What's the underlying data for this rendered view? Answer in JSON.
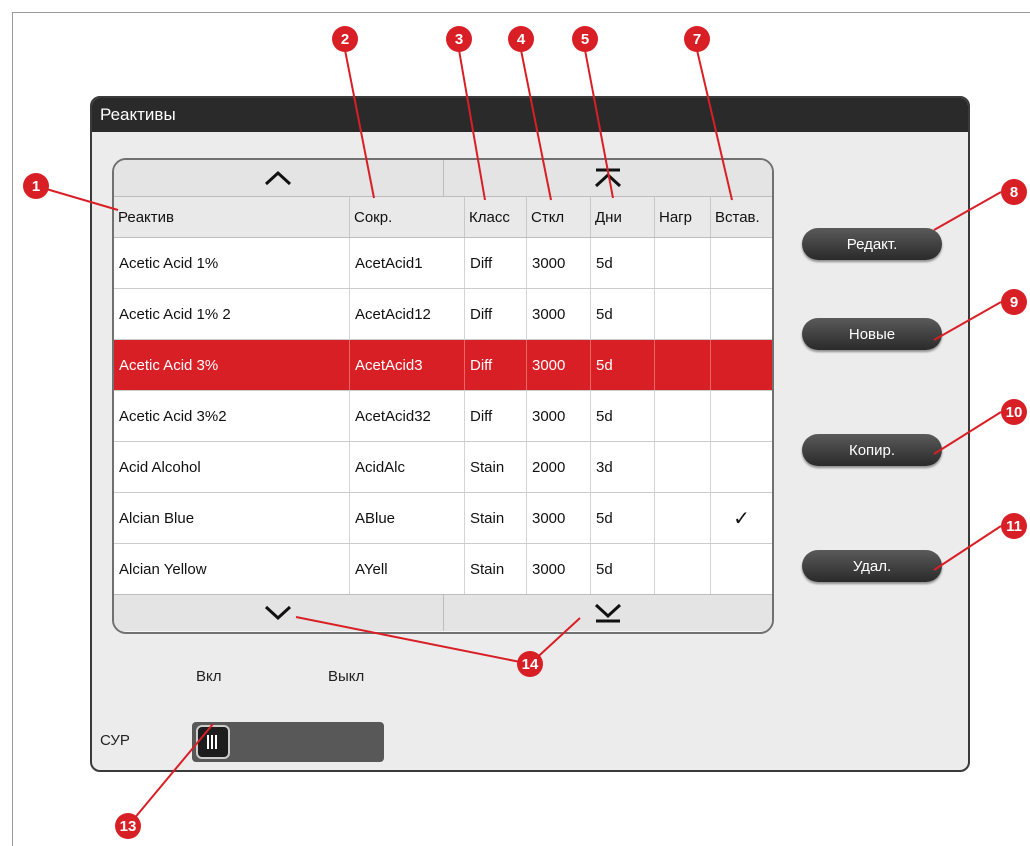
{
  "dialog": {
    "title": "Реактивы"
  },
  "table": {
    "columns": [
      "Реактив",
      "Сокр.",
      "Класс",
      "Сткл",
      "Дни",
      "Нагр",
      "Встав."
    ],
    "rows": [
      {
        "name": "Acetic Acid 1%",
        "abbr": "AcetAcid1",
        "class": "Diff",
        "stkl": "3000",
        "days": "5d",
        "nagr": "",
        "vstav": ""
      },
      {
        "name": "Acetic Acid 1% 2",
        "abbr": "AcetAcid12",
        "class": "Diff",
        "stkl": "3000",
        "days": "5d",
        "nagr": "",
        "vstav": ""
      },
      {
        "name": "Acetic Acid 3%",
        "abbr": "AcetAcid3",
        "class": "Diff",
        "stkl": "3000",
        "days": "5d",
        "nagr": "",
        "vstav": "",
        "selected": true
      },
      {
        "name": "Acetic Acid 3%2",
        "abbr": "AcetAcid32",
        "class": "Diff",
        "stkl": "3000",
        "days": "5d",
        "nagr": "",
        "vstav": ""
      },
      {
        "name": "Acid Alcohol",
        "abbr": "AcidAlc",
        "class": "Stain",
        "stkl": "2000",
        "days": "3d",
        "nagr": "",
        "vstav": ""
      },
      {
        "name": "Alcian Blue",
        "abbr": "ABlue",
        "class": "Stain",
        "stkl": "3000",
        "days": "5d",
        "nagr": "",
        "vstav": "✓"
      },
      {
        "name": "Alcian Yellow",
        "abbr": "AYell",
        "class": "Stain",
        "stkl": "3000",
        "days": "5d",
        "nagr": "",
        "vstav": ""
      }
    ]
  },
  "buttons": {
    "edit": "Редакт.",
    "new": "Новые",
    "copy": "Копир.",
    "delete": "Удал."
  },
  "switch": {
    "on_label": "Вкл",
    "off_label": "Выкл",
    "name": "СУР",
    "state": "on"
  },
  "callouts": [
    "1",
    "2",
    "3",
    "4",
    "5",
    "7",
    "8",
    "9",
    "10",
    "11",
    "13",
    "14"
  ],
  "colors": {
    "accent": "#d91f26",
    "header": "#2a2a2a",
    "button": "#3a3a3a"
  },
  "icons": {
    "scroll_up": "chevron-up-icon",
    "scroll_top": "double-up-icon",
    "scroll_down": "chevron-down-icon",
    "scroll_bottom": "double-down-icon",
    "check": "checkmark-icon"
  }
}
